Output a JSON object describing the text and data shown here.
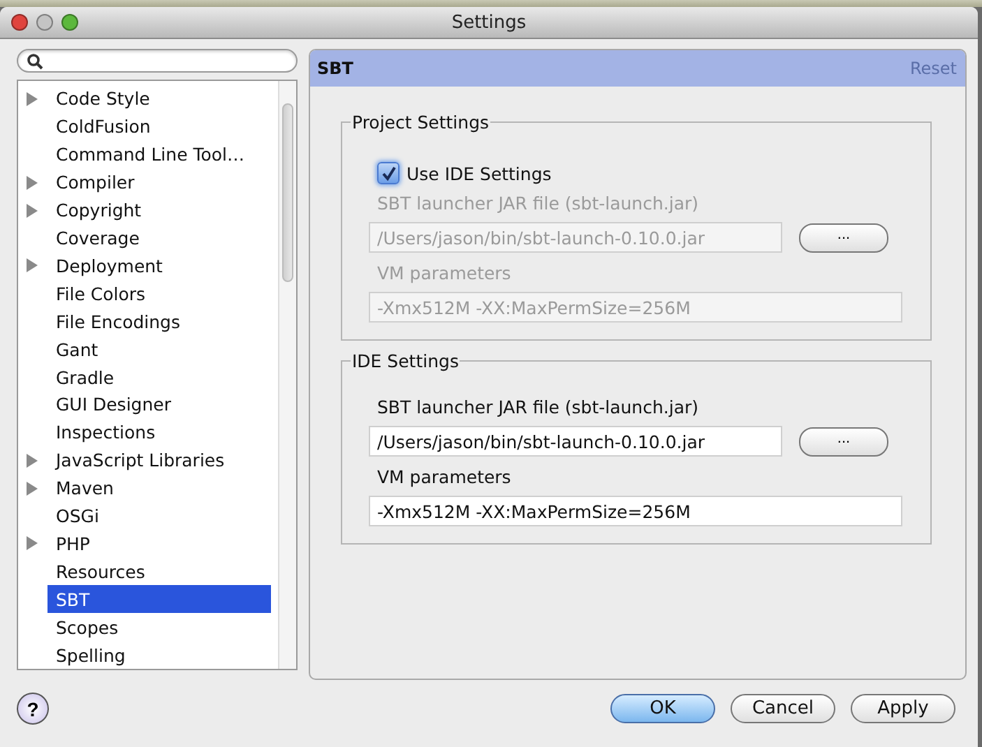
{
  "window": {
    "title": "Settings"
  },
  "sidebar": {
    "items": [
      {
        "label": "Code Style",
        "expandable": true,
        "selected": false
      },
      {
        "label": "ColdFusion",
        "expandable": false,
        "selected": false
      },
      {
        "label": "Command Line Tool…",
        "expandable": false,
        "selected": false
      },
      {
        "label": "Compiler",
        "expandable": true,
        "selected": false
      },
      {
        "label": "Copyright",
        "expandable": true,
        "selected": false
      },
      {
        "label": "Coverage",
        "expandable": false,
        "selected": false
      },
      {
        "label": "Deployment",
        "expandable": true,
        "selected": false
      },
      {
        "label": "File Colors",
        "expandable": false,
        "selected": false
      },
      {
        "label": "File Encodings",
        "expandable": false,
        "selected": false
      },
      {
        "label": "Gant",
        "expandable": false,
        "selected": false
      },
      {
        "label": "Gradle",
        "expandable": false,
        "selected": false
      },
      {
        "label": "GUI Designer",
        "expandable": false,
        "selected": false
      },
      {
        "label": "Inspections",
        "expandable": false,
        "selected": false
      },
      {
        "label": "JavaScript Libraries",
        "expandable": true,
        "selected": false
      },
      {
        "label": "Maven",
        "expandable": true,
        "selected": false
      },
      {
        "label": "OSGi",
        "expandable": false,
        "selected": false
      },
      {
        "label": "PHP",
        "expandable": true,
        "selected": false
      },
      {
        "label": "Resources",
        "expandable": false,
        "selected": false
      },
      {
        "label": "SBT",
        "expandable": false,
        "selected": true
      },
      {
        "label": "Scopes",
        "expandable": false,
        "selected": false
      },
      {
        "label": "Spelling",
        "expandable": false,
        "selected": false
      }
    ]
  },
  "panel": {
    "title": "SBT",
    "reset": "Reset",
    "groups": [
      {
        "title": "Project Settings",
        "checkbox": {
          "label": "Use IDE Settings",
          "checked": true
        },
        "disabled": true,
        "jar_label": "SBT launcher JAR file (sbt-launch.jar)",
        "jar_path": "/Users/jason/bin/sbt-launch-0.10.0.jar",
        "browse": "...",
        "vm_label": "VM parameters",
        "vm_params": "-Xmx512M -XX:MaxPermSize=256M"
      },
      {
        "title": "IDE Settings",
        "disabled": false,
        "jar_label": "SBT launcher JAR file (sbt-launch.jar)",
        "jar_path": "/Users/jason/bin/sbt-launch-0.10.0.jar",
        "browse": "...",
        "vm_label": "VM parameters",
        "vm_params": "-Xmx512M -XX:MaxPermSize=256M"
      }
    ]
  },
  "help": {
    "label": "?"
  },
  "buttons": [
    {
      "label": "OK",
      "default": true
    },
    {
      "label": "Cancel",
      "default": false
    },
    {
      "label": "Apply",
      "default": false
    }
  ]
}
